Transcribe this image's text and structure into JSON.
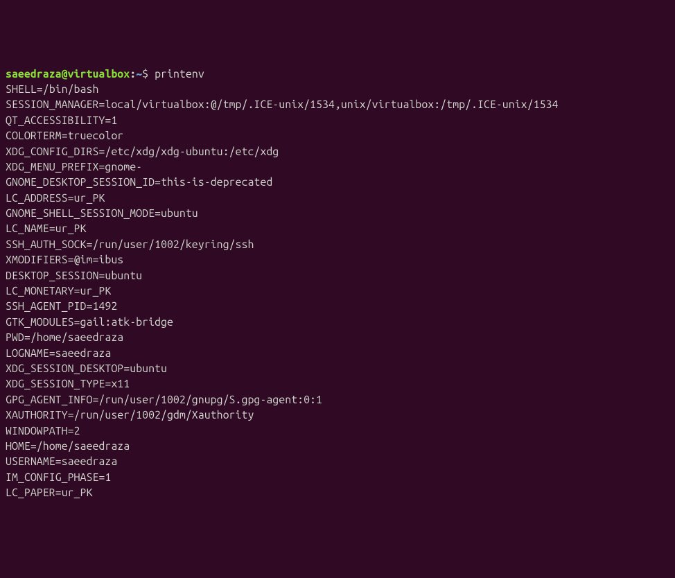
{
  "prompt": {
    "user": "saeedraza",
    "at": "@",
    "host": "virtualbox",
    "colon": ":",
    "path": "~",
    "dollar": "$"
  },
  "command": "printenv",
  "env": [
    "SHELL=/bin/bash",
    "SESSION_MANAGER=local/virtualbox:@/tmp/.ICE-unix/1534,unix/virtualbox:/tmp/.ICE-unix/1534",
    "QT_ACCESSIBILITY=1",
    "COLORTERM=truecolor",
    "XDG_CONFIG_DIRS=/etc/xdg/xdg-ubuntu:/etc/xdg",
    "XDG_MENU_PREFIX=gnome-",
    "GNOME_DESKTOP_SESSION_ID=this-is-deprecated",
    "LC_ADDRESS=ur_PK",
    "GNOME_SHELL_SESSION_MODE=ubuntu",
    "LC_NAME=ur_PK",
    "SSH_AUTH_SOCK=/run/user/1002/keyring/ssh",
    "XMODIFIERS=@im=ibus",
    "DESKTOP_SESSION=ubuntu",
    "LC_MONETARY=ur_PK",
    "SSH_AGENT_PID=1492",
    "GTK_MODULES=gail:atk-bridge",
    "PWD=/home/saeedraza",
    "LOGNAME=saeedraza",
    "XDG_SESSION_DESKTOP=ubuntu",
    "XDG_SESSION_TYPE=x11",
    "GPG_AGENT_INFO=/run/user/1002/gnupg/S.gpg-agent:0:1",
    "XAUTHORITY=/run/user/1002/gdm/Xauthority",
    "WINDOWPATH=2",
    "HOME=/home/saeedraza",
    "USERNAME=saeedraza",
    "IM_CONFIG_PHASE=1",
    "LC_PAPER=ur_PK"
  ]
}
